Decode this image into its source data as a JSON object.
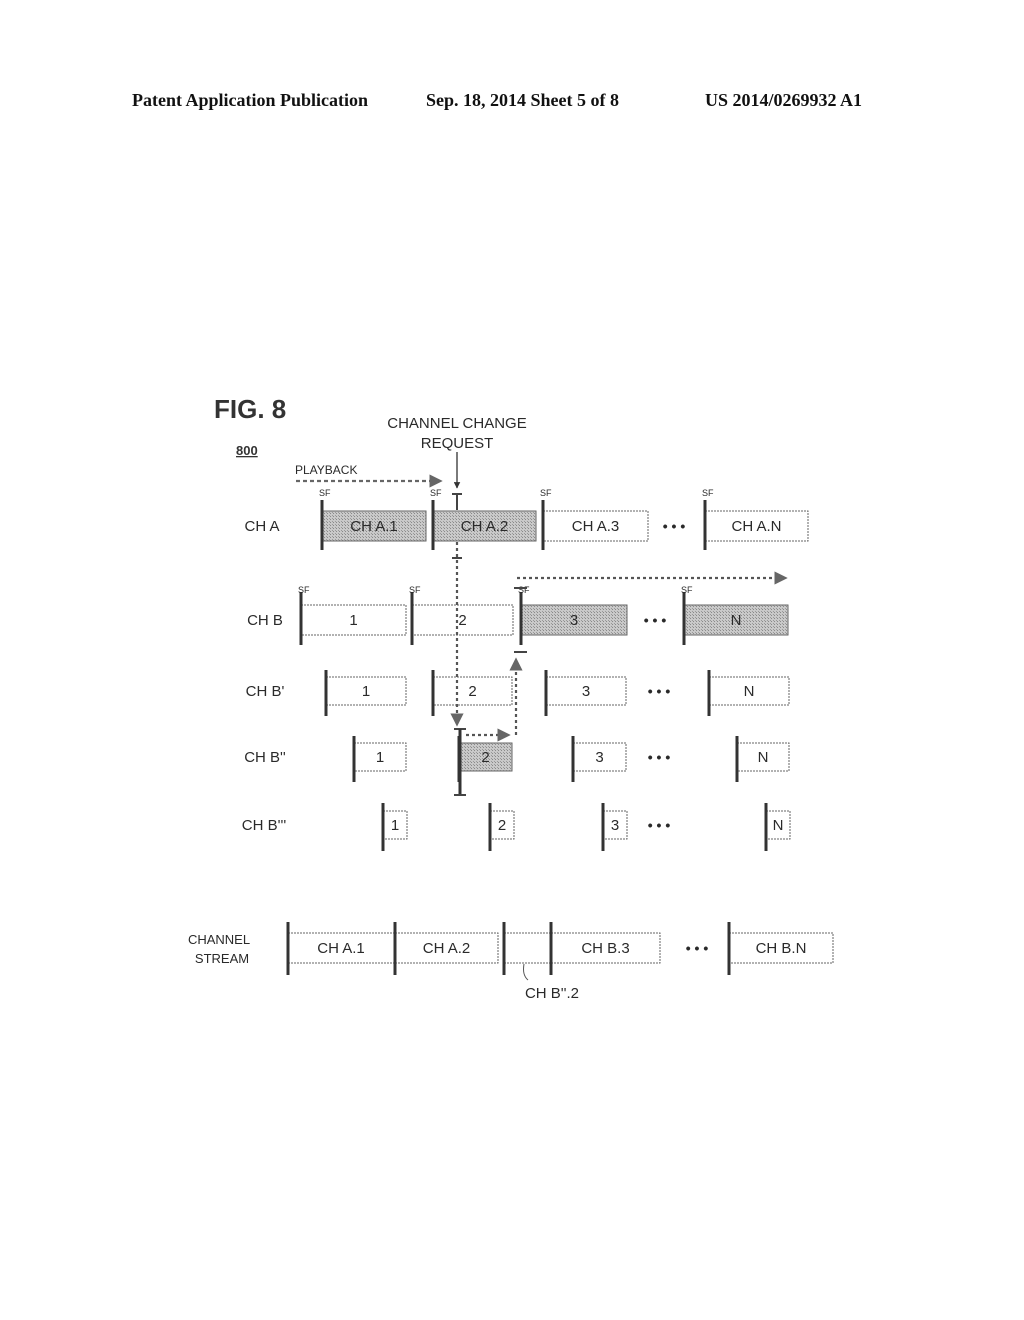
{
  "header": {
    "left": "Patent Application Publication",
    "middle": "Sep. 18, 2014   Sheet 5 of 8",
    "right": "US 2014/0269932 A1"
  },
  "figure": {
    "title": "FIG. 8",
    "ref_number": "800",
    "channel_change_label_line1": "CHANNEL CHANGE",
    "channel_change_label_line2": "REQUEST",
    "playback_label": "PLAYBACK",
    "sf_label": "SF",
    "ellipsis": "• • •",
    "colors": {
      "shaded": "#bcbcbc",
      "line": "#333333",
      "dotted": "#555555",
      "box_border": "#666666"
    }
  },
  "rows": [
    {
      "label": "CH A",
      "segments": [
        {
          "text": "CH A.1",
          "shaded": true,
          "sf": true
        },
        {
          "text": "CH A.2",
          "shaded": true,
          "sf": true
        },
        {
          "text": "CH A.3",
          "shaded": false,
          "sf": true
        },
        {
          "text": "CH A.N",
          "shaded": false,
          "sf": true
        }
      ]
    },
    {
      "label": "CH B",
      "segments": [
        {
          "text": "1",
          "shaded": false,
          "sf": true
        },
        {
          "text": "2",
          "shaded": false,
          "sf": true
        },
        {
          "text": "3",
          "shaded": true,
          "sf": true
        },
        {
          "text": "N",
          "shaded": true,
          "sf": true
        }
      ]
    },
    {
      "label": "CH B'",
      "segments": [
        {
          "text": "1",
          "shaded": false,
          "sf": false
        },
        {
          "text": "2",
          "shaded": false,
          "sf": false
        },
        {
          "text": "3",
          "shaded": false,
          "sf": false
        },
        {
          "text": "N",
          "shaded": false,
          "sf": false
        }
      ]
    },
    {
      "label": "CH B''",
      "segments": [
        {
          "text": "1",
          "shaded": false,
          "sf": false
        },
        {
          "text": "2",
          "shaded": true,
          "sf": false
        },
        {
          "text": "3",
          "shaded": false,
          "sf": false
        },
        {
          "text": "N",
          "shaded": false,
          "sf": false
        }
      ]
    },
    {
      "label": "CH B'''",
      "segments": [
        {
          "text": "1",
          "shaded": false,
          "sf": false
        },
        {
          "text": "2",
          "shaded": false,
          "sf": false
        },
        {
          "text": "3",
          "shaded": false,
          "sf": false
        },
        {
          "text": "N",
          "shaded": false,
          "sf": false
        }
      ]
    }
  ],
  "channel_stream": {
    "label_line1": "CHANNEL",
    "label_line2": "STREAM",
    "segments": [
      {
        "text": "CH A.1"
      },
      {
        "text": "CH A.2"
      },
      {
        "text": ""
      },
      {
        "text": "CH B.3"
      },
      {
        "text": "CH B.N"
      }
    ],
    "callout": "CH B''.2"
  }
}
